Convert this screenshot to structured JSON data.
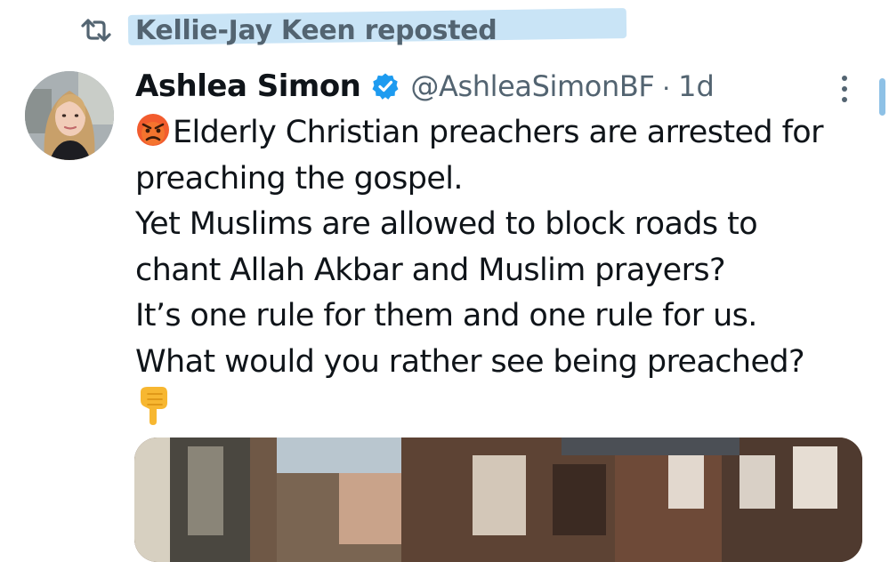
{
  "repost": {
    "icon": "repost-icon",
    "label": "Kellie-Jay Keen reposted"
  },
  "author": {
    "name": "Ashlea Simon",
    "verified_icon": "verified-badge-icon",
    "handle": "@AshleaSimonBF",
    "separator": "·",
    "time": "1d"
  },
  "tweet": {
    "lead_emoji": "angry-face-emoji",
    "lines": [
      "Elderly Christian preachers are arrested for",
      "preaching the gospel.",
      "Yet Muslims are allowed to block roads to",
      "chant Allah Akbar and Muslim prayers?",
      "It’s one rule for them and one rule for us.",
      "What would you rather see being preached?"
    ],
    "trail_emoji": "pointing-down-hand-emoji"
  },
  "media": {
    "type": "video-thumbnail"
  },
  "colors": {
    "accent": "#1d9bf0",
    "secondary_text": "#536471",
    "primary_text": "#0f1419",
    "highlight": "#87c4eb"
  }
}
